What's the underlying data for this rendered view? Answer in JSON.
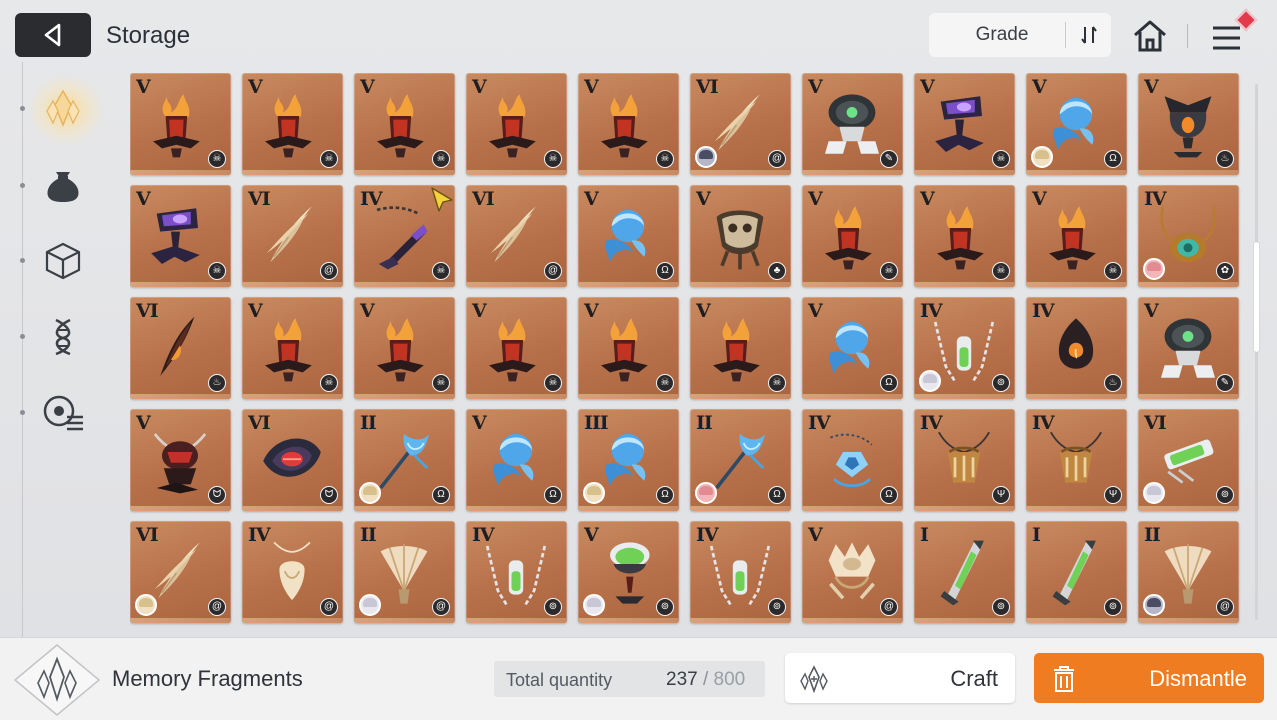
{
  "header": {
    "title": "Storage",
    "grade_sort_label": "Grade"
  },
  "footer": {
    "category_label": "Memory Fragments",
    "quantity_label": "Total quantity",
    "quantity_current": "237",
    "quantity_sep": "/",
    "quantity_max": "800",
    "craft_label": "Craft",
    "dismantle_label": "Dismantle"
  },
  "colors": {
    "dismantle": "#f07c22",
    "card": "#c08055",
    "selected_glow": "#ffd682"
  },
  "sidebar": {
    "items": [
      {
        "icon": "memory-fragment-icon",
        "selected": true
      },
      {
        "icon": "pouch-icon",
        "selected": false
      },
      {
        "icon": "cube-icon",
        "selected": false
      },
      {
        "icon": "helix-icon",
        "selected": false
      },
      {
        "icon": "disc-list-icon",
        "selected": false
      }
    ]
  },
  "items": [
    {
      "grade": "V",
      "art": "flame-chalice",
      "type": "skull"
    },
    {
      "grade": "V",
      "art": "flame-chalice",
      "type": "skull"
    },
    {
      "grade": "V",
      "art": "flame-chalice",
      "type": "skull"
    },
    {
      "grade": "V",
      "art": "flame-chalice",
      "type": "skull"
    },
    {
      "grade": "V",
      "art": "flame-chalice",
      "type": "skull"
    },
    {
      "grade": "VI",
      "art": "feather-wing",
      "type": "swirl",
      "avatar": "dark"
    },
    {
      "grade": "V",
      "art": "mech-pod",
      "type": "blade"
    },
    {
      "grade": "V",
      "art": "void-chalice",
      "type": "skull"
    },
    {
      "grade": "V",
      "art": "water-orb",
      "type": "omega",
      "avatar": "blonde"
    },
    {
      "grade": "V",
      "art": "dark-urn",
      "type": "fire"
    },
    {
      "grade": "V",
      "art": "void-chalice",
      "type": "skull"
    },
    {
      "grade": "VI",
      "art": "feather-wing",
      "type": "swirl"
    },
    {
      "grade": "IV",
      "art": "chain-dagger",
      "type": "skull"
    },
    {
      "grade": "VI",
      "art": "feather-wing",
      "type": "swirl"
    },
    {
      "grade": "V",
      "art": "water-orb",
      "type": "omega"
    },
    {
      "grade": "V",
      "art": "root-pot",
      "type": "leaf"
    },
    {
      "grade": "V",
      "art": "flame-chalice",
      "type": "skull"
    },
    {
      "grade": "V",
      "art": "flame-chalice",
      "type": "skull"
    },
    {
      "grade": "V",
      "art": "flame-chalice",
      "type": "skull"
    },
    {
      "grade": "IV",
      "art": "jade-necklace",
      "type": "beast",
      "avatar": "pink"
    },
    {
      "grade": "VI",
      "art": "ember-feather",
      "type": "fire"
    },
    {
      "grade": "V",
      "art": "flame-chalice",
      "type": "skull"
    },
    {
      "grade": "V",
      "art": "flame-chalice",
      "type": "skull"
    },
    {
      "grade": "V",
      "art": "flame-chalice",
      "type": "skull"
    },
    {
      "grade": "V",
      "art": "flame-chalice",
      "type": "skull"
    },
    {
      "grade": "V",
      "art": "flame-chalice",
      "type": "skull"
    },
    {
      "grade": "V",
      "art": "water-orb",
      "type": "omega"
    },
    {
      "grade": "IV",
      "art": "vial-chain",
      "type": "spiral",
      "avatar": "white"
    },
    {
      "grade": "IV",
      "art": "ember-lantern",
      "type": "fire"
    },
    {
      "grade": "V",
      "art": "mech-pod",
      "type": "blade"
    },
    {
      "grade": "V",
      "art": "horned-idol",
      "type": "wing"
    },
    {
      "grade": "VI",
      "art": "crimson-shell",
      "type": "wing"
    },
    {
      "grade": "II",
      "art": "water-sigil",
      "type": "omega",
      "avatar": "blonde"
    },
    {
      "grade": "V",
      "art": "water-orb",
      "type": "omega"
    },
    {
      "grade": "III",
      "art": "water-orb",
      "type": "omega",
      "avatar": "blonde"
    },
    {
      "grade": "II",
      "art": "water-sigil",
      "type": "omega",
      "avatar": "pink"
    },
    {
      "grade": "IV",
      "art": "ice-chain",
      "type": "omega"
    },
    {
      "grade": "IV",
      "art": "trident-amulet",
      "type": "trident"
    },
    {
      "grade": "IV",
      "art": "trident-amulet",
      "type": "trident"
    },
    {
      "grade": "VI",
      "art": "green-syringe",
      "type": "spiral",
      "avatar": "white"
    },
    {
      "grade": "VI",
      "art": "feather-wing",
      "type": "swirl",
      "avatar": "blonde"
    },
    {
      "grade": "IV",
      "art": "shell-pendant",
      "type": "swirl"
    },
    {
      "grade": "II",
      "art": "bone-fan",
      "type": "swirl",
      "avatar": "white"
    },
    {
      "grade": "IV",
      "art": "vial-chain",
      "type": "spiral"
    },
    {
      "grade": "V",
      "art": "potion-goblet",
      "type": "spiral",
      "avatar": "white"
    },
    {
      "grade": "IV",
      "art": "vial-chain",
      "type": "spiral"
    },
    {
      "grade": "V",
      "art": "bone-crown",
      "type": "swirl"
    },
    {
      "grade": "I",
      "art": "green-blade",
      "type": "spiral"
    },
    {
      "grade": "I",
      "art": "green-blade",
      "type": "spiral"
    },
    {
      "grade": "II",
      "art": "bone-fan",
      "type": "swirl",
      "avatar": "dark"
    }
  ]
}
